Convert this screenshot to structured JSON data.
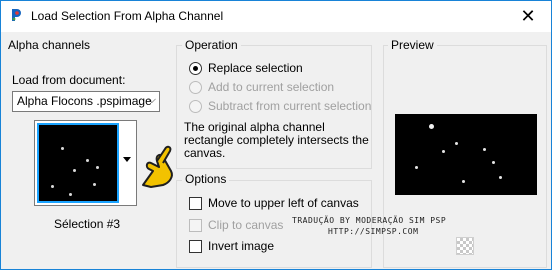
{
  "window": {
    "title": "Load Selection From Alpha Channel",
    "close_glyph": "✕"
  },
  "alpha_channels": {
    "title": "Alpha channels",
    "load_from_label": "Load from document:",
    "document_value": "Alpha Flocons .pspimage",
    "selection_label": "Sélection #3"
  },
  "operation": {
    "title": "Operation",
    "options": [
      {
        "label": "Replace selection",
        "checked": true,
        "enabled": true
      },
      {
        "label": "Add to current selection",
        "checked": false,
        "enabled": false
      },
      {
        "label": "Subtract from current selection",
        "checked": false,
        "enabled": false
      }
    ],
    "description": "The original alpha channel rectangle completely intersects the canvas."
  },
  "options": {
    "title": "Options",
    "items": [
      {
        "label": "Move to upper left of canvas",
        "checked": false,
        "enabled": true
      },
      {
        "label": "Clip to canvas",
        "checked": false,
        "enabled": false
      },
      {
        "label": "Invert image",
        "checked": false,
        "enabled": true
      }
    ]
  },
  "preview": {
    "title": "Preview"
  },
  "watermark": {
    "line1": "TRADUÇÃO BY MODERAÇÃO SIM PSP",
    "line2": "HTTP://SIMPSP.COM"
  },
  "icons": {
    "app": "paint-shop-pro-icon",
    "close": "close-icon",
    "dropdown": "chevron-down-icon",
    "pointer": "hand-pointer-icon",
    "checker": "transparency-checker-icon"
  },
  "colors": {
    "accent": "#1aa3ff",
    "pointer_fill": "#f2c200"
  }
}
